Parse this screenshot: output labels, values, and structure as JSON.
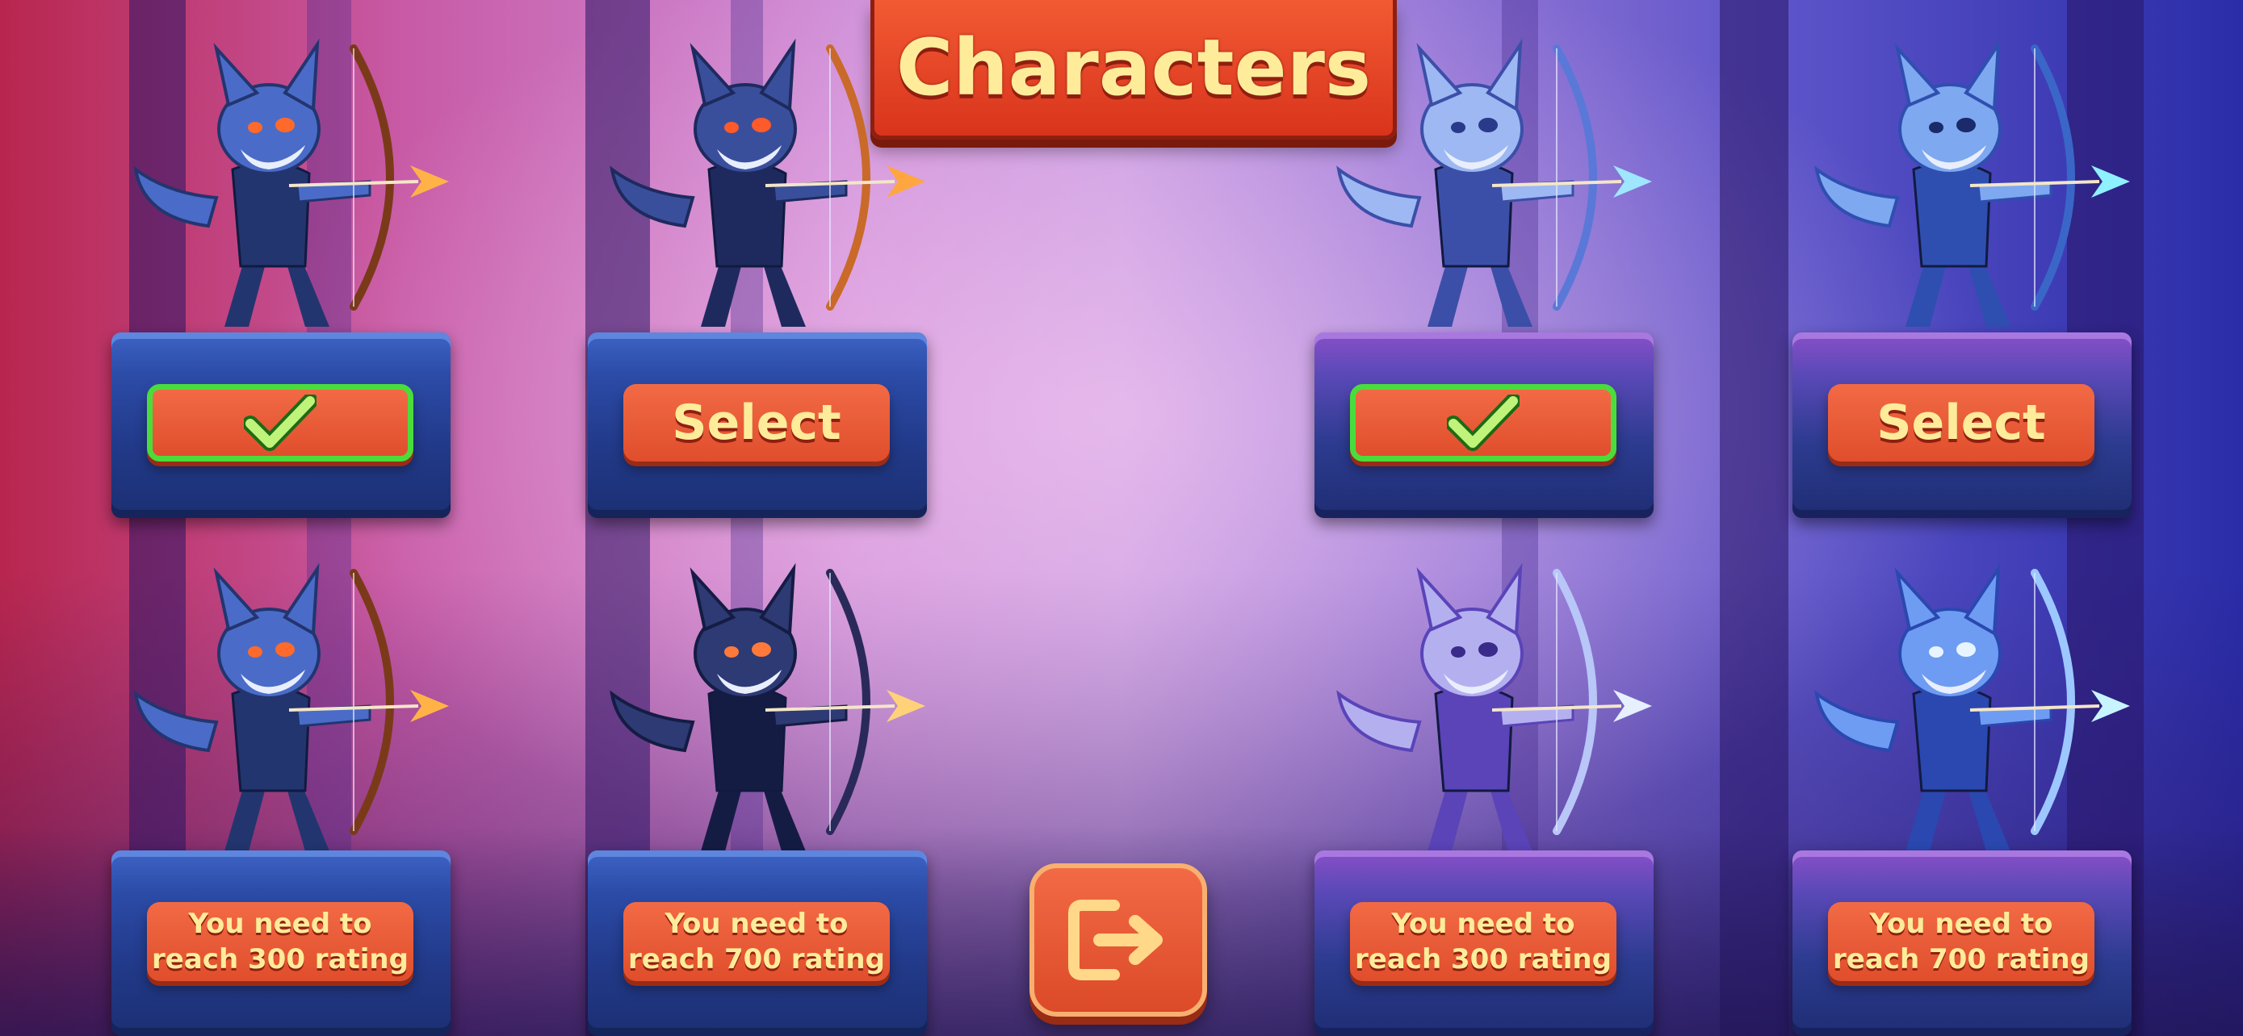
{
  "screen": {
    "title": "Characters"
  },
  "characters": [
    {
      "id": "fire-fox",
      "button": {
        "type": "selected",
        "label": "",
        "icon": "checkmark-icon"
      }
    },
    {
      "id": "ember-wolf",
      "button": {
        "type": "select",
        "label": "Select"
      }
    },
    {
      "id": "frost-fox",
      "button": {
        "type": "selected",
        "label": "",
        "icon": "checkmark-icon"
      }
    },
    {
      "id": "ice-wolf",
      "button": {
        "type": "select",
        "label": "Select"
      }
    },
    {
      "id": "flame-cat",
      "button": {
        "type": "locked",
        "line1": "You need to",
        "line2": "reach 300 rating"
      }
    },
    {
      "id": "shadow-wolf",
      "button": {
        "type": "locked",
        "line1": "You need to",
        "line2": "reach 700 rating"
      }
    },
    {
      "id": "lavender-fox",
      "button": {
        "type": "locked",
        "line1": "You need to",
        "line2": "reach 300 rating"
      }
    },
    {
      "id": "crystal-cat",
      "button": {
        "type": "locked",
        "line1": "You need to",
        "line2": "reach 700 rating"
      }
    }
  ],
  "exit_button": {
    "icon": "exit-icon"
  },
  "colors": {
    "button": "#e65530",
    "button_text": "#ffec9a",
    "selected_border": "#4bdc3c",
    "fire_arrow": "#ffb347",
    "ice_arrow": "#9fe6ff"
  }
}
